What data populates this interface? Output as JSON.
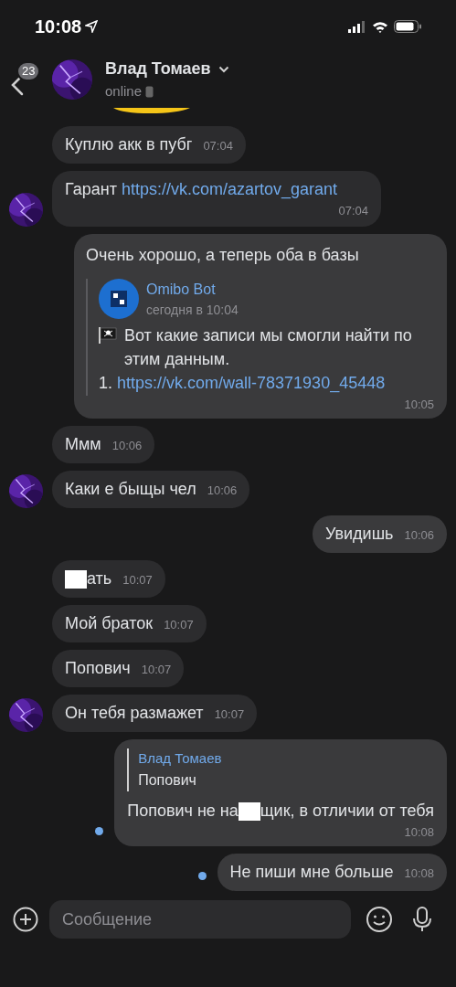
{
  "status_bar": {
    "time": "10:08"
  },
  "header": {
    "back_badge": "23",
    "name": "Влад Томаев",
    "status": "online"
  },
  "messages": [
    {
      "kind": "text",
      "outgoing": false,
      "avatar": false,
      "parts": [
        {
          "kind": "text",
          "text": "Куплю акк в пубг"
        }
      ],
      "time": "07:04"
    },
    {
      "kind": "text",
      "outgoing": false,
      "avatar": true,
      "parts": [
        {
          "kind": "text",
          "text": "Гарант "
        },
        {
          "kind": "link",
          "text": "https://vk.com/azartov_garant"
        }
      ],
      "time": "07:04"
    },
    {
      "kind": "forwarded",
      "outgoing": true,
      "unread": false,
      "text": "Очень хорошо, а теперь оба в базы",
      "forward": {
        "author": "Omibo Bot",
        "date": "сегодня в 10:04",
        "body": "Вот какие записи мы смогли найти по этим данным.",
        "link_prefix": "1. ",
        "link": "https://vk.com/wall-78371930_45448"
      },
      "time": "10:05"
    },
    {
      "kind": "text",
      "outgoing": false,
      "avatar": false,
      "parts": [
        {
          "kind": "text",
          "text": "Ммм"
        }
      ],
      "time": "10:06"
    },
    {
      "kind": "text",
      "outgoing": false,
      "avatar": true,
      "parts": [
        {
          "kind": "text",
          "text": "Каки е быщы чел"
        }
      ],
      "time": "10:06"
    },
    {
      "kind": "text",
      "outgoing": true,
      "unread": false,
      "parts": [
        {
          "kind": "text",
          "text": "Увидишь"
        }
      ],
      "time": "10:06"
    },
    {
      "kind": "text",
      "outgoing": false,
      "avatar": false,
      "parts": [
        {
          "kind": "redacted"
        },
        {
          "kind": "text",
          "text": "ать"
        }
      ],
      "time": "10:07"
    },
    {
      "kind": "text",
      "outgoing": false,
      "avatar": false,
      "parts": [
        {
          "kind": "text",
          "text": "Мой браток"
        }
      ],
      "time": "10:07"
    },
    {
      "kind": "text",
      "outgoing": false,
      "avatar": false,
      "parts": [
        {
          "kind": "text",
          "text": "Попович"
        }
      ],
      "time": "10:07"
    },
    {
      "kind": "text",
      "outgoing": false,
      "avatar": true,
      "parts": [
        {
          "kind": "text",
          "text": "Он тебя размажет"
        }
      ],
      "time": "10:07"
    },
    {
      "kind": "reply",
      "outgoing": true,
      "unread": true,
      "quote": {
        "author": "Влад Томаев",
        "text": "Попович"
      },
      "parts": [
        {
          "kind": "text",
          "text": "Попович не на"
        },
        {
          "kind": "redacted"
        },
        {
          "kind": "text",
          "text": "щик, в отличии от тебя"
        }
      ],
      "time": "10:08"
    },
    {
      "kind": "text",
      "outgoing": true,
      "unread": true,
      "parts": [
        {
          "kind": "text",
          "text": "Не пиши мне больше"
        }
      ],
      "time": "10:08"
    }
  ],
  "composer": {
    "placeholder": "Сообщение"
  }
}
